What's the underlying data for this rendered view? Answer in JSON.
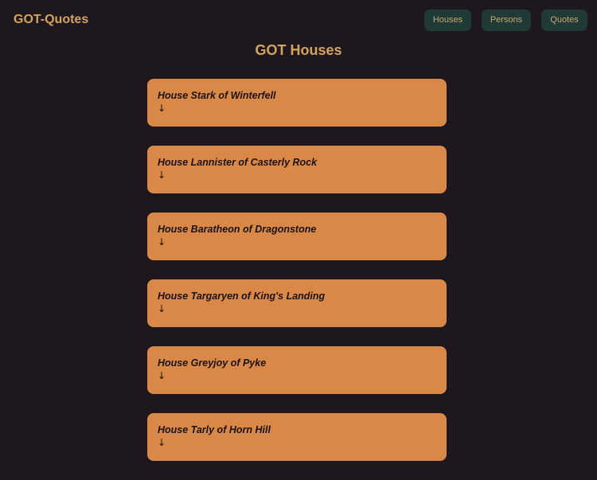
{
  "brand": "GOT-Quotes",
  "nav": {
    "houses_label": "Houses",
    "persons_label": "Persons",
    "quotes_label": "Quotes"
  },
  "page_title": "GOT Houses",
  "houses": [
    {
      "name": "House Stark of Winterfell",
      "arrow": "↓"
    },
    {
      "name": "House Lannister of Casterly Rock",
      "arrow": "↓"
    },
    {
      "name": "House Baratheon of Dragonstone",
      "arrow": "↓"
    },
    {
      "name": "House Targaryen of King's Landing",
      "arrow": "↓"
    },
    {
      "name": "House Greyjoy of Pyke",
      "arrow": "↓"
    },
    {
      "name": "House Tarly of Horn Hill",
      "arrow": "↓"
    }
  ],
  "colors": {
    "background": "#1e171d",
    "accent": "#d4a361",
    "nav_button_bg": "#1f3a37",
    "card_bg": "#d98848"
  }
}
